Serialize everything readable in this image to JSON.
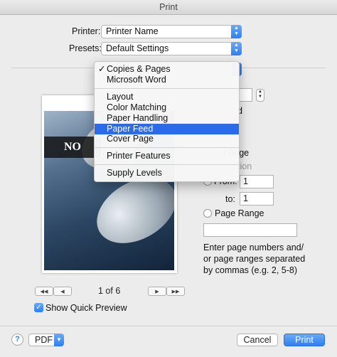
{
  "window": {
    "title": "Print"
  },
  "printer": {
    "label": "Printer:",
    "value": "Printer Name"
  },
  "presets": {
    "label": "Presets:",
    "value": "Default Settings"
  },
  "menu": {
    "check_mark": "✓",
    "items": [
      "Copies & Pages",
      "Microsoft Word",
      "Layout",
      "Color Matching",
      "Paper Handling",
      "Paper Feed",
      "Cover Page",
      "Printer Features",
      "Supply Levels"
    ],
    "selected": "Copies & Pages",
    "highlighted": "Paper Feed"
  },
  "pages": {
    "all_partial": "t Page",
    "selection_partial": "tion",
    "collated_partial": "d",
    "from_label": "From:",
    "from_value": "1",
    "to_label": "to:",
    "to_value": "1",
    "range_label": "Page Range",
    "range_value": "",
    "help_text": "Enter page numbers and/ or page ranges separated by commas (e.g. 2, 5-8)"
  },
  "preview": {
    "banner_text": "NO",
    "page_indicator": "1 of 6",
    "show_quick_preview_label": "Show Quick Preview",
    "show_quick_preview_checked": true
  },
  "footer": {
    "help": "?",
    "pdf_label": "PDF",
    "cancel_label": "Cancel",
    "print_label": "Print"
  },
  "colors": {
    "accent": "#2f7ff0",
    "highlight": "#2b6bea"
  }
}
